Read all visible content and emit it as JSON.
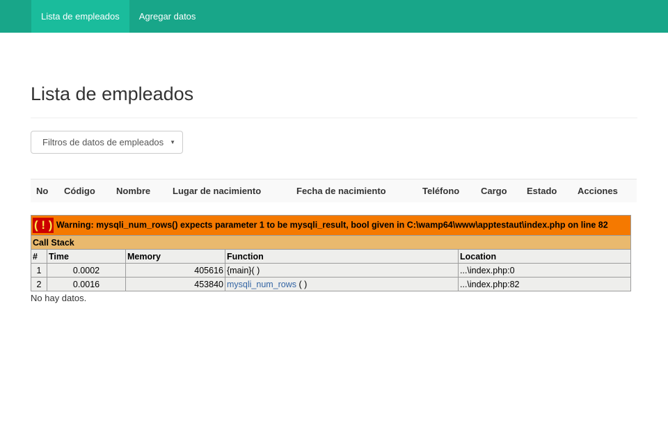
{
  "nav": {
    "items": [
      {
        "label": "Lista de empleados",
        "active": true
      },
      {
        "label": "Agregar datos",
        "active": false
      }
    ]
  },
  "page": {
    "title": "Lista de empleados",
    "filter_label": "Filtros de datos de empleados"
  },
  "table": {
    "headers": [
      "No",
      "Código",
      "Nombre",
      "Lugar de nacimiento",
      "Fecha de nacimiento",
      "Teléfono",
      "Cargo",
      "Estado",
      "Acciones"
    ]
  },
  "error": {
    "icon": "( ! )",
    "message": "Warning: mysqli_num_rows() expects parameter 1 to be mysqli_result, bool given in C:\\wamp64\\www\\apptestaut\\index.php on line 82",
    "callstack_label": "Call Stack",
    "columns": [
      "#",
      "Time",
      "Memory",
      "Function",
      "Location"
    ],
    "rows": [
      {
        "n": "1",
        "time": "0.0002",
        "memory": "405616",
        "function": "{main}( )",
        "function_link": false,
        "location": "...\\index.php:0"
      },
      {
        "n": "2",
        "time": "0.0016",
        "memory": "453840",
        "function": "mysqli_num_rows",
        "function_suffix": " ( )",
        "function_link": true,
        "location": "...\\index.php:82"
      }
    ]
  },
  "status": {
    "no_data": "No hay datos."
  },
  "colors": {
    "navbar": "#18a689",
    "nav_active": "#1abc9c",
    "warning_bg": "#f57900",
    "callstack_bg": "#e9b96e",
    "link": "#3465a4"
  }
}
